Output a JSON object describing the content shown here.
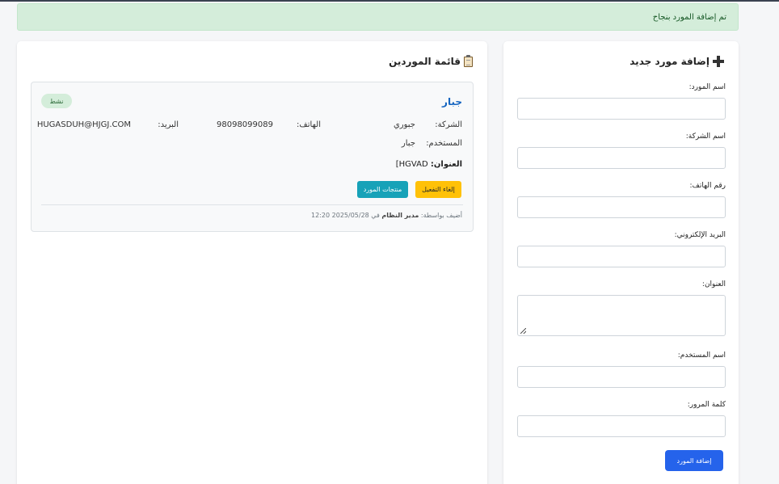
{
  "alert": {
    "message": "تم إضافة المورد بنجاح"
  },
  "list": {
    "title": "قائمة الموردين",
    "suppliers": [
      {
        "name": "جبار",
        "status": "نشط",
        "company_label": "الشركة:",
        "company_value": "جبوري",
        "phone_label": "الهاتف:",
        "phone_value": "98098099089",
        "email_label": "البريد:",
        "email_value": "HUGASDUH@HJGJ.COM",
        "username_label": "المستخدم:",
        "username_value": "جبار",
        "address_label": "العنوان:",
        "address_value": "HGVAD]",
        "deactivate_label": "إلغاء التفعيل",
        "products_label": "منتجات المورد",
        "meta_prefix": "أضيف بواسطة:",
        "meta_user": "مدير النظام",
        "meta_on": "في",
        "meta_datetime": "2025/05/28 12:20"
      }
    ]
  },
  "form": {
    "title": "إضافة مورد جديد",
    "supplier_name_label": "اسم المورد:",
    "company_name_label": "اسم الشركة:",
    "phone_label": "رقم الهاتف:",
    "email_label": "البريد الإلكتروني:",
    "address_label": "العنوان:",
    "username_label": "اسم المستخدم:",
    "password_label": "كلمة المرور:",
    "submit_label": "إضافة المورد"
  },
  "colors": {
    "accent": "#2563eb",
    "success_bg": "#d4edda",
    "warning": "#ffc107",
    "info": "#17a2b8",
    "link": "#1565c0"
  },
  "icons": {
    "list_title": "clipboard-icon",
    "form_title": "plus-icon"
  }
}
